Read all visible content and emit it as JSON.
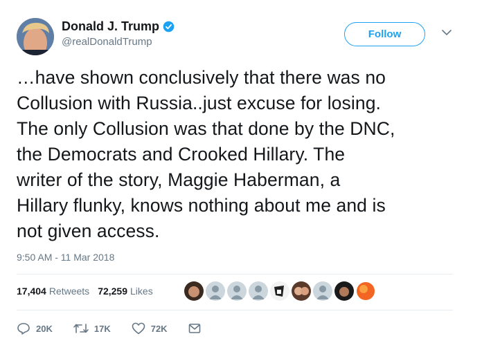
{
  "author": {
    "display_name": "Donald J. Trump",
    "handle": "@realDonaldTrump"
  },
  "follow_label": "Follow",
  "tweet_lines": [
    "…have shown conclusively that there was no",
    "Collusion with Russia..just excuse for losing.",
    "The only Collusion was that done by the DNC,",
    "the Democrats and Crooked Hillary. The",
    "writer of the story, Maggie Haberman, a",
    "Hillary flunky, knows nothing about me and is",
    "not given access."
  ],
  "timestamp": "9:50 AM - 11 Mar 2018",
  "stats": {
    "retweets_count": "17,404",
    "retweets_label": "Retweets",
    "likes_count": "72,259",
    "likes_label": "Likes"
  },
  "actions": {
    "replies": "20K",
    "retweets": "17K",
    "likes": "72K"
  },
  "colors": {
    "accent": "#1da1f2",
    "muted": "#657786",
    "text": "#14171a"
  }
}
